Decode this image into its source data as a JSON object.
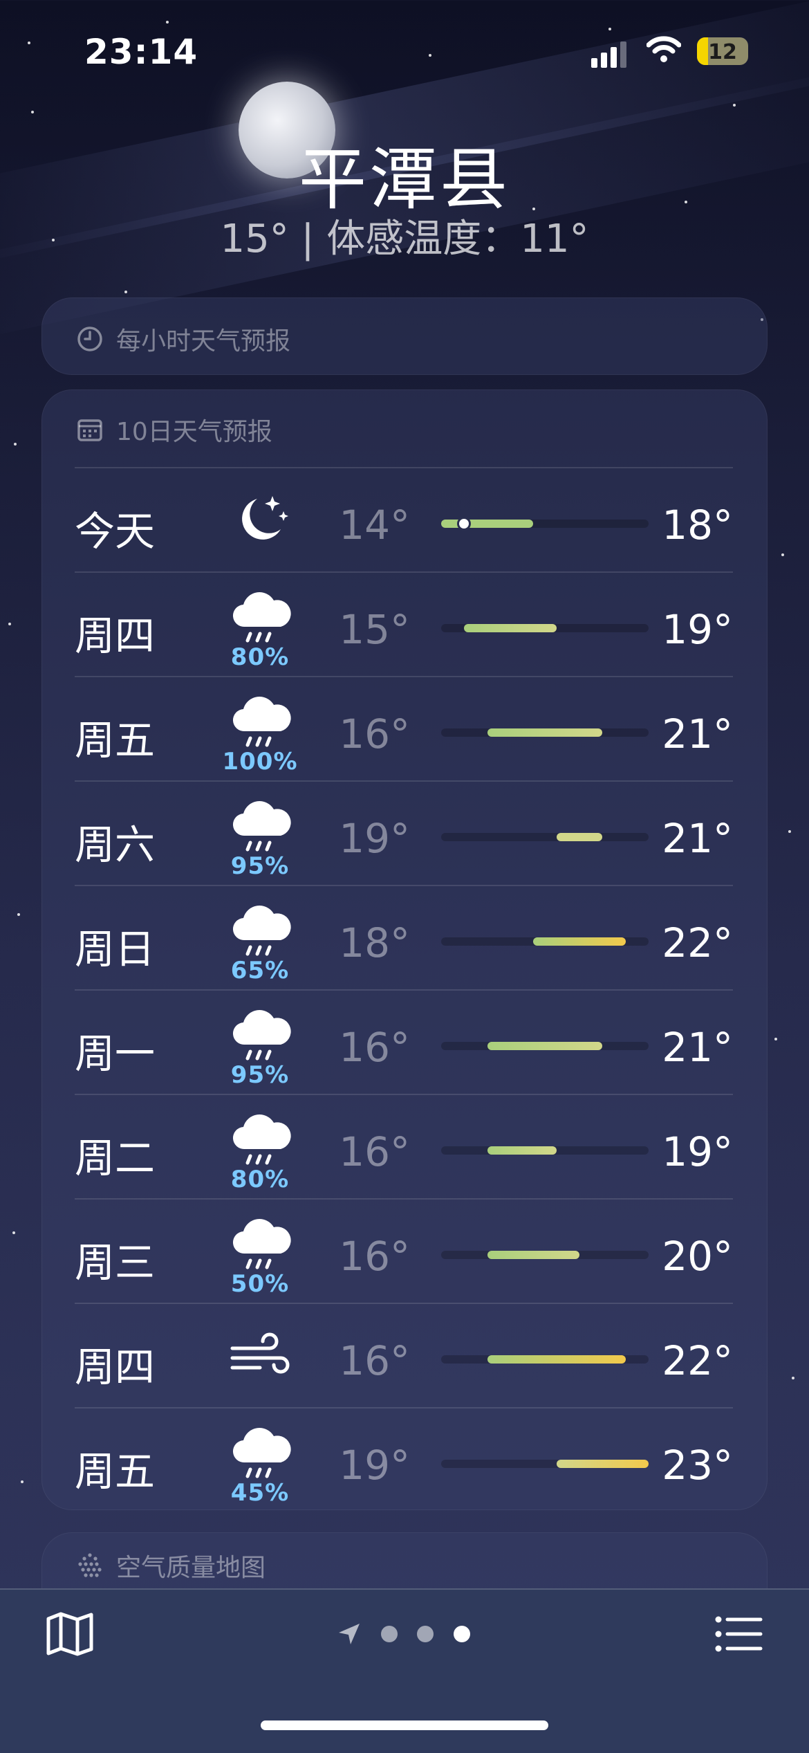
{
  "status_bar": {
    "time": "23:14",
    "battery": "12"
  },
  "location": {
    "city": "平潭县",
    "current_line": "15° | 体感温度：11°"
  },
  "hourly_card": {
    "title": "每小时天气预报"
  },
  "forecast_card": {
    "title": "10日天气预报",
    "range": {
      "min": 14,
      "max": 23
    },
    "days": [
      {
        "day": "今天",
        "icon": "moon-stars-icon",
        "precip": "",
        "low": "14°",
        "high": "18°",
        "low_val": 14,
        "high_val": 18,
        "current_val": 15
      },
      {
        "day": "周四",
        "icon": "cloud-rain-icon",
        "precip": "80%",
        "low": "15°",
        "high": "19°",
        "low_val": 15,
        "high_val": 19
      },
      {
        "day": "周五",
        "icon": "cloud-rain-icon",
        "precip": "100%",
        "low": "16°",
        "high": "21°",
        "low_val": 16,
        "high_val": 21
      },
      {
        "day": "周六",
        "icon": "cloud-rain-icon",
        "precip": "95%",
        "low": "19°",
        "high": "21°",
        "low_val": 19,
        "high_val": 21
      },
      {
        "day": "周日",
        "icon": "cloud-rain-icon",
        "precip": "65%",
        "low": "18°",
        "high": "22°",
        "low_val": 18,
        "high_val": 22
      },
      {
        "day": "周一",
        "icon": "cloud-rain-icon",
        "precip": "95%",
        "low": "16°",
        "high": "21°",
        "low_val": 16,
        "high_val": 21
      },
      {
        "day": "周二",
        "icon": "cloud-rain-icon",
        "precip": "80%",
        "low": "16°",
        "high": "19°",
        "low_val": 16,
        "high_val": 19
      },
      {
        "day": "周三",
        "icon": "cloud-rain-icon",
        "precip": "50%",
        "low": "16°",
        "high": "20°",
        "low_val": 16,
        "high_val": 20
      },
      {
        "day": "周四",
        "icon": "wind-icon",
        "precip": "",
        "low": "16°",
        "high": "22°",
        "low_val": 16,
        "high_val": 22
      },
      {
        "day": "周五",
        "icon": "cloud-rain-icon",
        "precip": "45%",
        "low": "19°",
        "high": "23°",
        "low_val": 19,
        "high_val": 23
      }
    ]
  },
  "air_card": {
    "title": "空气质量地图"
  },
  "colors": {
    "precip": "#7cc9ff",
    "bar_cool": "#a9cf7c",
    "bar_mid": "#d2d78a",
    "bar_warm": "#f2c94c"
  },
  "tab_bar": {
    "left_icon": "map-icon",
    "right_icon": "list-icon",
    "pages": [
      "location-arrow-icon",
      "page-dot",
      "page-dot",
      "page-dot-active"
    ]
  }
}
